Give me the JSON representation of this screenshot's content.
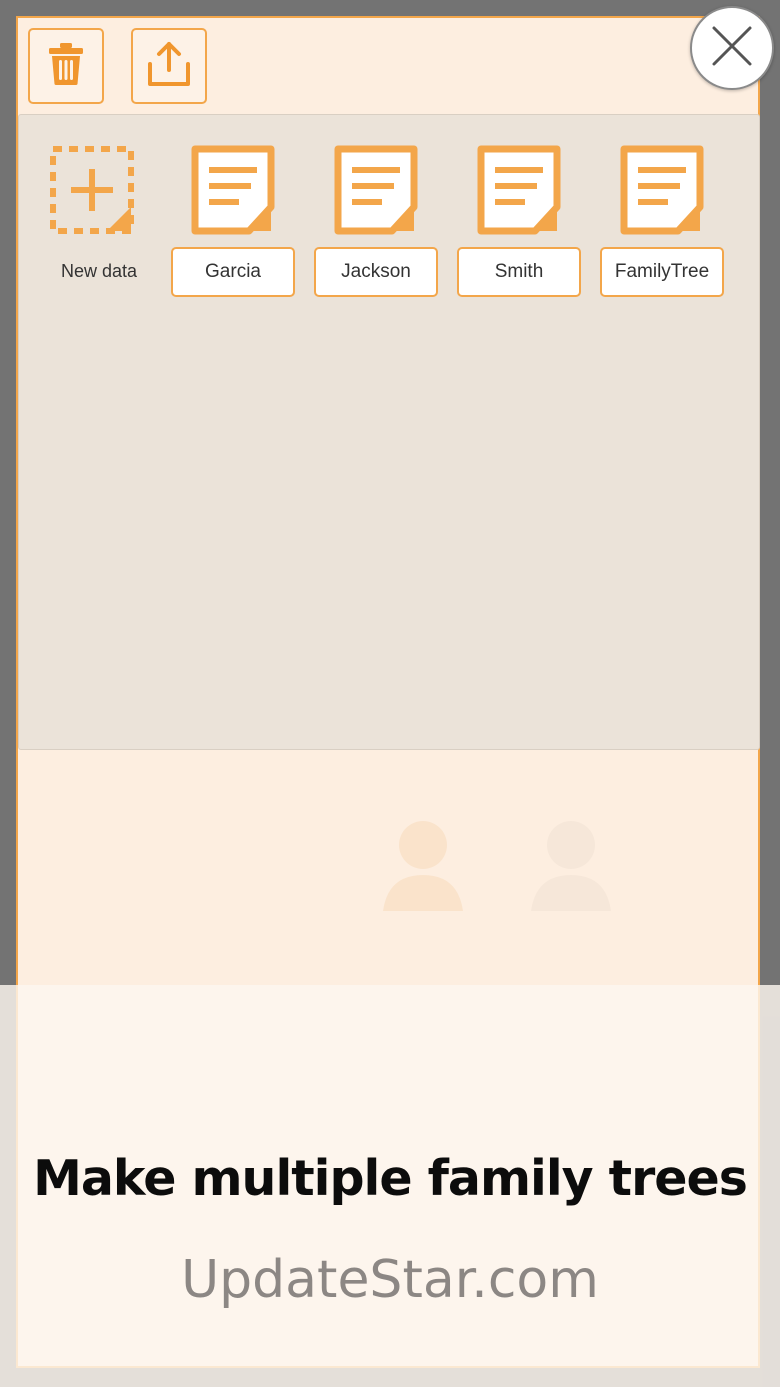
{
  "toolbar": {
    "delete_icon": "trash-icon",
    "export_icon": "upload-icon",
    "close_icon": "close-icon"
  },
  "files": {
    "new_label": "New data",
    "items": [
      {
        "label": "Garcia"
      },
      {
        "label": "Jackson"
      },
      {
        "label": "Smith"
      },
      {
        "label": "FamilyTree"
      }
    ]
  },
  "caption": {
    "title": "Make multiple family trees",
    "watermark": "UpdateStar.com"
  },
  "colors": {
    "accent": "#f3a64a",
    "panel": "#fdeee0",
    "list_bg": "#ebe3d9"
  }
}
